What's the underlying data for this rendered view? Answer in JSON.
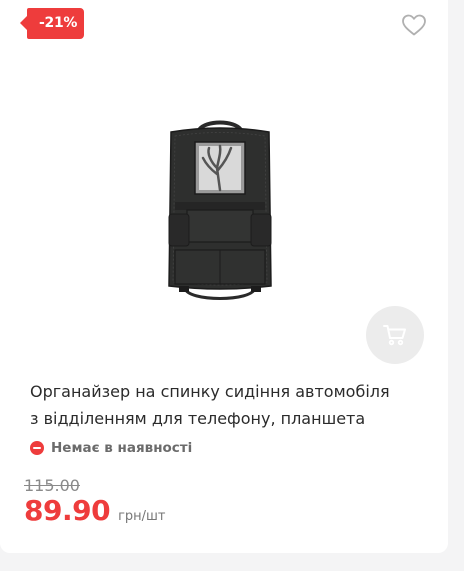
{
  "product": {
    "discount_badge": "-21%",
    "title_line1": "Органайзер на спинку сидіння автомобіля",
    "title_line2": "з відділенням для телефону, планшета",
    "availability": "Немає в наявності",
    "old_price": "115.00",
    "price": "89.90",
    "price_unit": "грн/шт"
  },
  "icons": {
    "wishlist": "heart-outline-icon",
    "cart": "shopping-cart-icon",
    "availability": "minus-circle-icon"
  },
  "colors": {
    "accent": "#ee3c3c",
    "text": "#2b2b2b",
    "muted": "#777777",
    "background": "#f4f4f5",
    "card": "#ffffff",
    "cart_button_bg": "#ececec"
  }
}
